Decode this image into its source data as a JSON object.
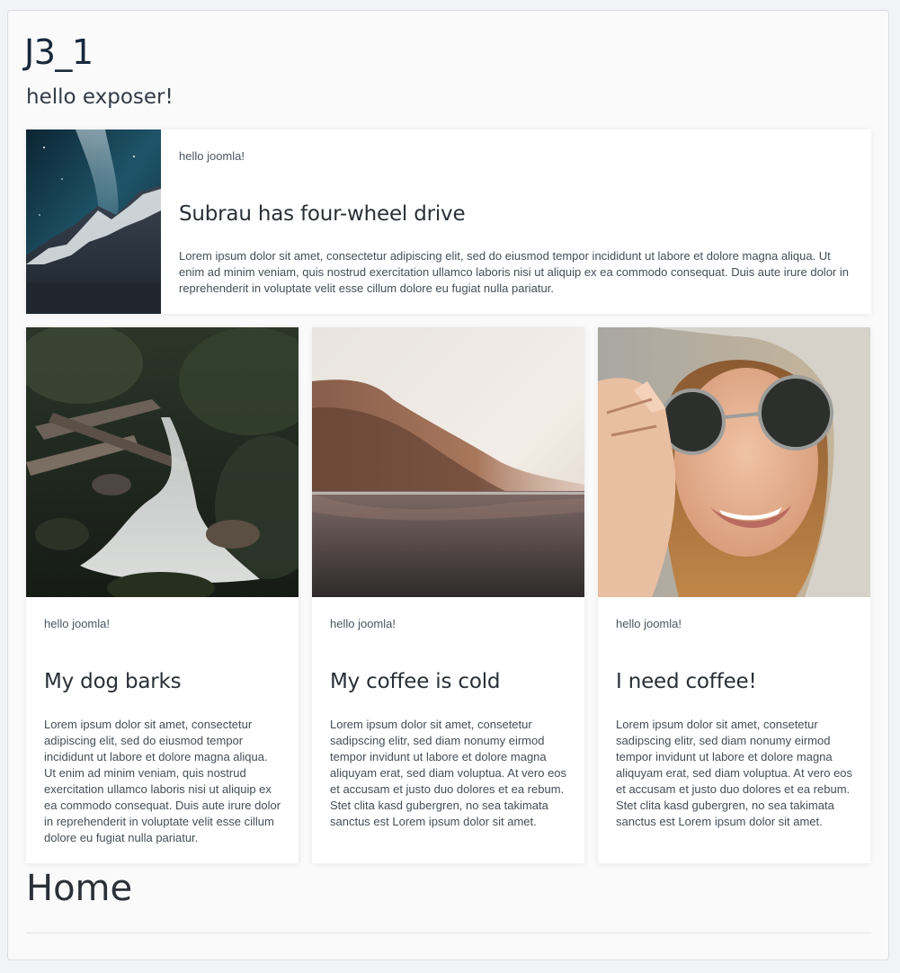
{
  "site": {
    "title": "J3_1",
    "subtitle": "hello exposer!"
  },
  "featured": {
    "image": "mountain-night-sky-image",
    "meta": "hello joomla!",
    "title": "Subrau has four-wheel drive",
    "text": "Lorem ipsum dolor sit amet, consectetur adipiscing elit, sed do eiusmod tempor incididunt ut labore et dolore magna aliqua. Ut enim ad minim veniam, quis nostrud exercitation ullamco laboris nisi ut aliquip ex ea commodo consequat. Duis aute irure dolor in reprehenderit in voluptate velit esse cillum dolore eu fugiat nulla pariatur."
  },
  "cards": [
    {
      "image": "forest-waterfall-image",
      "meta": "hello joomla!",
      "title": "My dog barks",
      "text": "Lorem ipsum dolor sit amet, consectetur adipiscing elit, sed do eiusmod tempor incididunt ut labore et dolore magna aliqua. Ut enim ad minim veniam, quis nostrud exercitation ullamco laboris nisi ut aliquip ex ea commodo consequat. Duis aute irure dolor in reprehenderit in voluptate velit esse cillum dolore eu fugiat nulla pariatur."
    },
    {
      "image": "misty-lake-image",
      "meta": "hello joomla!",
      "title": "My coffee is cold",
      "text": "Lorem ipsum dolor sit amet, consetetur sadipscing elitr, sed diam nonumy eirmod tempor invidunt ut labore et dolore magna aliquyam erat, sed diam voluptua. At vero eos et accusam et justo duo dolores et ea rebum. Stet clita kasd gubergren, no sea takimata sanctus est Lorem ipsum dolor sit amet."
    },
    {
      "image": "woman-sunglasses-image",
      "meta": "hello joomla!",
      "title": "I need coffee!",
      "text": "Lorem ipsum dolor sit amet, consetetur sadipscing elitr, sed diam nonumy eirmod tempor invidunt ut labore et dolore magna aliquyam erat, sed diam voluptua. At vero eos et accusam et justo duo dolores et ea rebum. Stet clita kasd gubergren, no sea takimata sanctus est Lorem ipsum dolor sit amet."
    }
  ],
  "section": {
    "heading": "Home"
  }
}
